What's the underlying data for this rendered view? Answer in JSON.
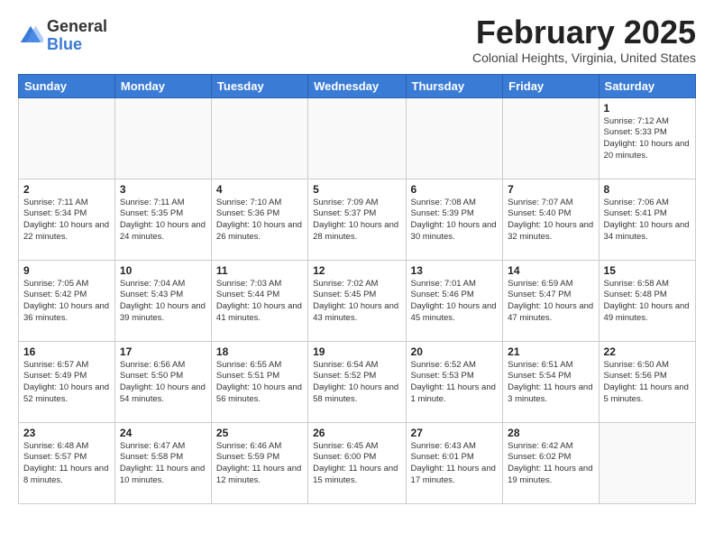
{
  "logo": {
    "general": "General",
    "blue": "Blue"
  },
  "header": {
    "month": "February 2025",
    "location": "Colonial Heights, Virginia, United States"
  },
  "days_of_week": [
    "Sunday",
    "Monday",
    "Tuesday",
    "Wednesday",
    "Thursday",
    "Friday",
    "Saturday"
  ],
  "weeks": [
    [
      {
        "day": "",
        "info": ""
      },
      {
        "day": "",
        "info": ""
      },
      {
        "day": "",
        "info": ""
      },
      {
        "day": "",
        "info": ""
      },
      {
        "day": "",
        "info": ""
      },
      {
        "day": "",
        "info": ""
      },
      {
        "day": "1",
        "info": "Sunrise: 7:12 AM\nSunset: 5:33 PM\nDaylight: 10 hours and 20 minutes."
      }
    ],
    [
      {
        "day": "2",
        "info": "Sunrise: 7:11 AM\nSunset: 5:34 PM\nDaylight: 10 hours and 22 minutes."
      },
      {
        "day": "3",
        "info": "Sunrise: 7:11 AM\nSunset: 5:35 PM\nDaylight: 10 hours and 24 minutes."
      },
      {
        "day": "4",
        "info": "Sunrise: 7:10 AM\nSunset: 5:36 PM\nDaylight: 10 hours and 26 minutes."
      },
      {
        "day": "5",
        "info": "Sunrise: 7:09 AM\nSunset: 5:37 PM\nDaylight: 10 hours and 28 minutes."
      },
      {
        "day": "6",
        "info": "Sunrise: 7:08 AM\nSunset: 5:39 PM\nDaylight: 10 hours and 30 minutes."
      },
      {
        "day": "7",
        "info": "Sunrise: 7:07 AM\nSunset: 5:40 PM\nDaylight: 10 hours and 32 minutes."
      },
      {
        "day": "8",
        "info": "Sunrise: 7:06 AM\nSunset: 5:41 PM\nDaylight: 10 hours and 34 minutes."
      }
    ],
    [
      {
        "day": "9",
        "info": "Sunrise: 7:05 AM\nSunset: 5:42 PM\nDaylight: 10 hours and 36 minutes."
      },
      {
        "day": "10",
        "info": "Sunrise: 7:04 AM\nSunset: 5:43 PM\nDaylight: 10 hours and 39 minutes."
      },
      {
        "day": "11",
        "info": "Sunrise: 7:03 AM\nSunset: 5:44 PM\nDaylight: 10 hours and 41 minutes."
      },
      {
        "day": "12",
        "info": "Sunrise: 7:02 AM\nSunset: 5:45 PM\nDaylight: 10 hours and 43 minutes."
      },
      {
        "day": "13",
        "info": "Sunrise: 7:01 AM\nSunset: 5:46 PM\nDaylight: 10 hours and 45 minutes."
      },
      {
        "day": "14",
        "info": "Sunrise: 6:59 AM\nSunset: 5:47 PM\nDaylight: 10 hours and 47 minutes."
      },
      {
        "day": "15",
        "info": "Sunrise: 6:58 AM\nSunset: 5:48 PM\nDaylight: 10 hours and 49 minutes."
      }
    ],
    [
      {
        "day": "16",
        "info": "Sunrise: 6:57 AM\nSunset: 5:49 PM\nDaylight: 10 hours and 52 minutes."
      },
      {
        "day": "17",
        "info": "Sunrise: 6:56 AM\nSunset: 5:50 PM\nDaylight: 10 hours and 54 minutes."
      },
      {
        "day": "18",
        "info": "Sunrise: 6:55 AM\nSunset: 5:51 PM\nDaylight: 10 hours and 56 minutes."
      },
      {
        "day": "19",
        "info": "Sunrise: 6:54 AM\nSunset: 5:52 PM\nDaylight: 10 hours and 58 minutes."
      },
      {
        "day": "20",
        "info": "Sunrise: 6:52 AM\nSunset: 5:53 PM\nDaylight: 11 hours and 1 minute."
      },
      {
        "day": "21",
        "info": "Sunrise: 6:51 AM\nSunset: 5:54 PM\nDaylight: 11 hours and 3 minutes."
      },
      {
        "day": "22",
        "info": "Sunrise: 6:50 AM\nSunset: 5:56 PM\nDaylight: 11 hours and 5 minutes."
      }
    ],
    [
      {
        "day": "23",
        "info": "Sunrise: 6:48 AM\nSunset: 5:57 PM\nDaylight: 11 hours and 8 minutes."
      },
      {
        "day": "24",
        "info": "Sunrise: 6:47 AM\nSunset: 5:58 PM\nDaylight: 11 hours and 10 minutes."
      },
      {
        "day": "25",
        "info": "Sunrise: 6:46 AM\nSunset: 5:59 PM\nDaylight: 11 hours and 12 minutes."
      },
      {
        "day": "26",
        "info": "Sunrise: 6:45 AM\nSunset: 6:00 PM\nDaylight: 11 hours and 15 minutes."
      },
      {
        "day": "27",
        "info": "Sunrise: 6:43 AM\nSunset: 6:01 PM\nDaylight: 11 hours and 17 minutes."
      },
      {
        "day": "28",
        "info": "Sunrise: 6:42 AM\nSunset: 6:02 PM\nDaylight: 11 hours and 19 minutes."
      },
      {
        "day": "",
        "info": ""
      }
    ]
  ]
}
